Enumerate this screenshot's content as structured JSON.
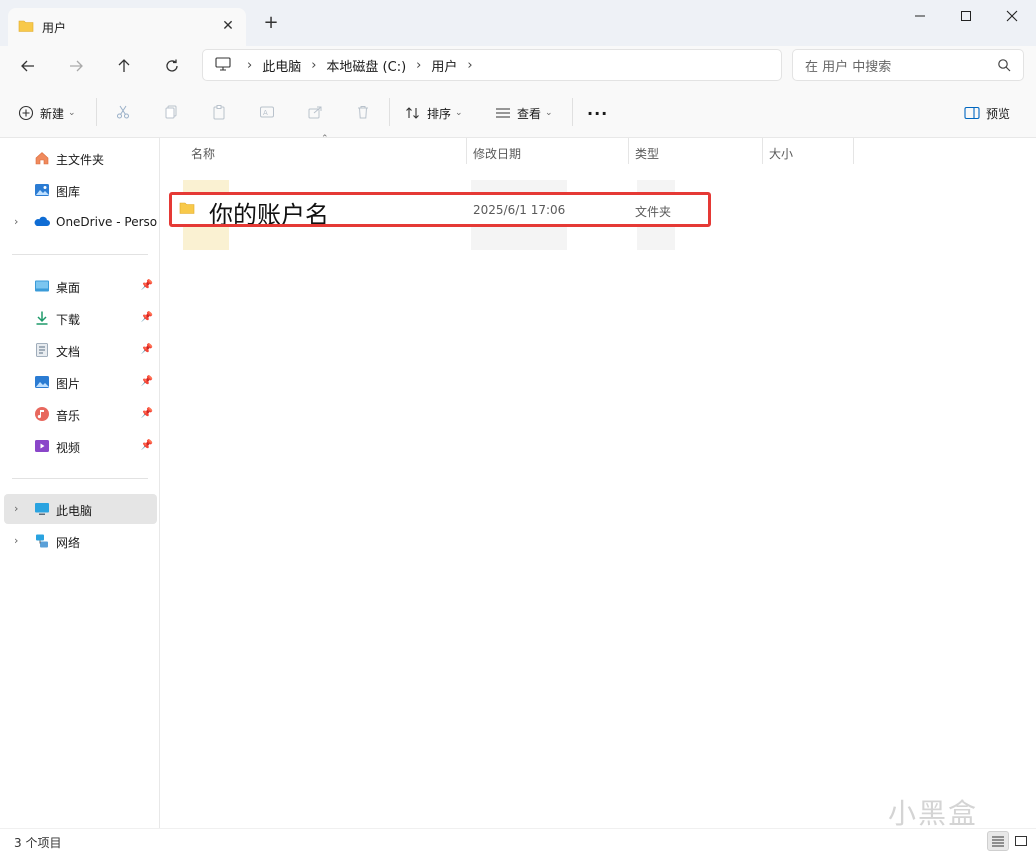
{
  "window": {
    "tab_title": "用户",
    "new_tab": "+",
    "close_tab": "✕"
  },
  "navigation": {
    "breadcrumbs": [
      "此电脑",
      "本地磁盘 (C:)",
      "用户"
    ],
    "search_placeholder": "在 用户 中搜索"
  },
  "toolbar": {
    "new_label": "新建",
    "sort_label": "排序",
    "view_label": "查看",
    "more_label": "···",
    "preview_label": "预览"
  },
  "sidebar": {
    "quick": [
      {
        "label": "主文件夹",
        "icon": "home-icon"
      },
      {
        "label": "图库",
        "icon": "gallery-icon"
      },
      {
        "label": "OneDrive - Perso",
        "icon": "onedrive-icon"
      }
    ],
    "pinned": [
      {
        "label": "桌面",
        "icon": "desktop-icon"
      },
      {
        "label": "下载",
        "icon": "download-icon"
      },
      {
        "label": "文档",
        "icon": "document-icon"
      },
      {
        "label": "图片",
        "icon": "pictures-icon"
      },
      {
        "label": "音乐",
        "icon": "music-icon"
      },
      {
        "label": "视频",
        "icon": "video-icon"
      }
    ],
    "devices": [
      {
        "label": "此电脑",
        "icon": "this-pc-icon",
        "selected": true
      },
      {
        "label": "网络",
        "icon": "network-icon"
      }
    ]
  },
  "columns": {
    "name": "名称",
    "modified": "修改日期",
    "type": "类型",
    "size": "大小"
  },
  "files": [
    {
      "name": "你的账户名",
      "modified": "2025/6/1 17:06",
      "type": "文件夹",
      "size": ""
    }
  ],
  "status": {
    "item_count": "3 个项目"
  },
  "watermark": "小黑盒",
  "colors": {
    "highlight_border": "#e53935",
    "folder": "#f8c94a",
    "accent": "#0067c0"
  }
}
